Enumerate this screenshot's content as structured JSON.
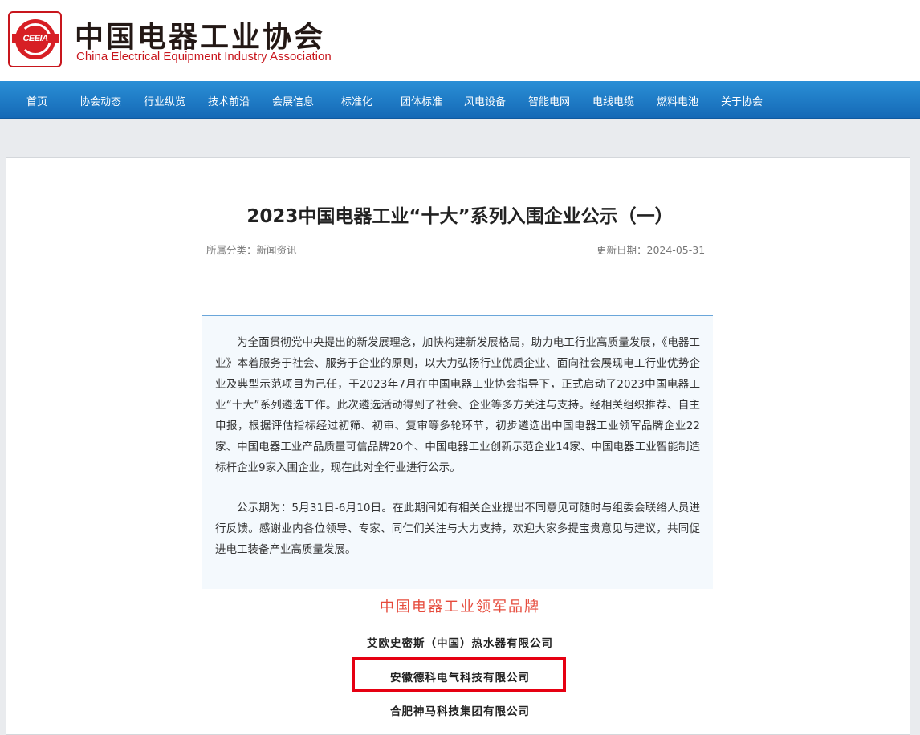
{
  "header": {
    "logo_text": "CEEIA",
    "brand_cn": "中国电器工业协会",
    "brand_en": "China Electrical Equipment Industry Association"
  },
  "nav": {
    "items": [
      {
        "label": "首页"
      },
      {
        "label": "协会动态"
      },
      {
        "label": "行业纵览"
      },
      {
        "label": "技术前沿"
      },
      {
        "label": "会展信息"
      },
      {
        "label": "标准化"
      },
      {
        "label": "团体标准"
      },
      {
        "label": "风电设备"
      },
      {
        "label": "智能电网"
      },
      {
        "label": "电线电缆"
      },
      {
        "label": "燃料电池"
      },
      {
        "label": "关于协会"
      }
    ]
  },
  "article": {
    "title": "2023中国电器工业“十大”系列入围企业公示（一）",
    "category": "所属分类：新闻资讯",
    "updated": "更新日期：2024-05-31",
    "paragraphs": [
      "为全面贯彻党中央提出的新发展理念，加快构建新发展格局，助力电工行业高质量发展，《电器工业》本着服务于社会、服务于企业的原则，以大力弘扬行业优质企业、面向社会展现电工行业优势企业及典型示范项目为己任，于2023年7月在中国电器工业协会指导下，正式启动了2023中国电器工业“十大”系列遴选工作。此次遴选活动得到了社会、企业等多方关注与支持。经相关组织推荐、自主申报，根据评估指标经过初筛、初审、复审等多轮环节，初步遴选出中国电器工业领军品牌企业22家、中国电器工业产品质量可信品牌20个、中国电器工业创新示范企业14家、中国电器工业智能制造标杆企业9家入围企业，现在此对全行业进行公示。",
      "公示期为：5月31日-6月10日。在此期间如有相关企业提出不同意见可随时与组委会联络人员进行反馈。感谢业内各位领导、专家、同仁们关注与大力支持，欢迎大家多提宝贵意见与建议，共同促进电工装备产业高质量发展。"
    ],
    "section_title": "中国电器工业领军品牌",
    "companies": [
      "艾欧史密斯（中国）热水器有限公司",
      "安徽德科电气科技有限公司",
      "合肥神马科技集团有限公司"
    ]
  },
  "colors": {
    "nav_top": "#2a8fd6",
    "nav_bottom": "#1569b6",
    "brand_red": "#c8161d",
    "section_red": "#e64b3c",
    "highlight_red": "#e60012"
  }
}
